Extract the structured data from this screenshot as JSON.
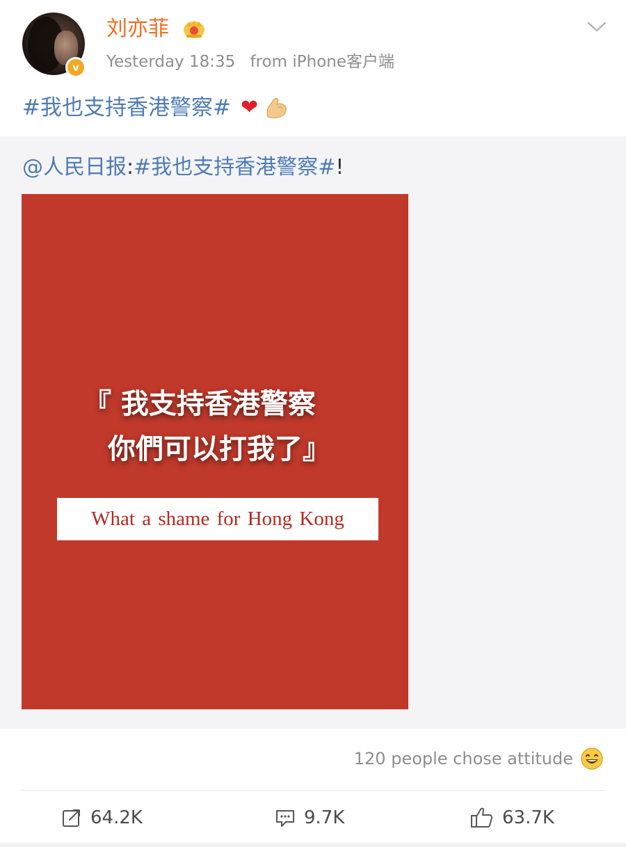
{
  "post": {
    "author": "刘亦菲",
    "timestamp": "Yesterday 18:35",
    "source": "from iPhone客户端",
    "text": "#我也支持香港警察#",
    "emojis": [
      "❤️",
      "💪"
    ]
  },
  "repost": {
    "mention": "@人民日报",
    "separator": ":",
    "hashtag": "#我也支持香港警察#",
    "suffix": "!",
    "poster": {
      "line1": "『 我支持香港警察",
      "line2": "你們可以打我了』",
      "caption": "What a shame for Hong Kong",
      "background_color": "#c0392b"
    }
  },
  "footer": {
    "attitude_text": "120 people chose attitude",
    "repost_count": "64.2K",
    "comment_count": "9.7K",
    "like_count": "63.7K"
  },
  "colors": {
    "username": "#f26d21",
    "link": "#4e7bb5",
    "meta": "#8e8e8e"
  },
  "icons": [
    "verified-badge-icon",
    "crown-icon",
    "chevron-down-icon",
    "heart-emoji-icon",
    "flexed-biceps-icon",
    "grinning-face-icon",
    "repost-icon",
    "comment-icon",
    "like-icon"
  ]
}
